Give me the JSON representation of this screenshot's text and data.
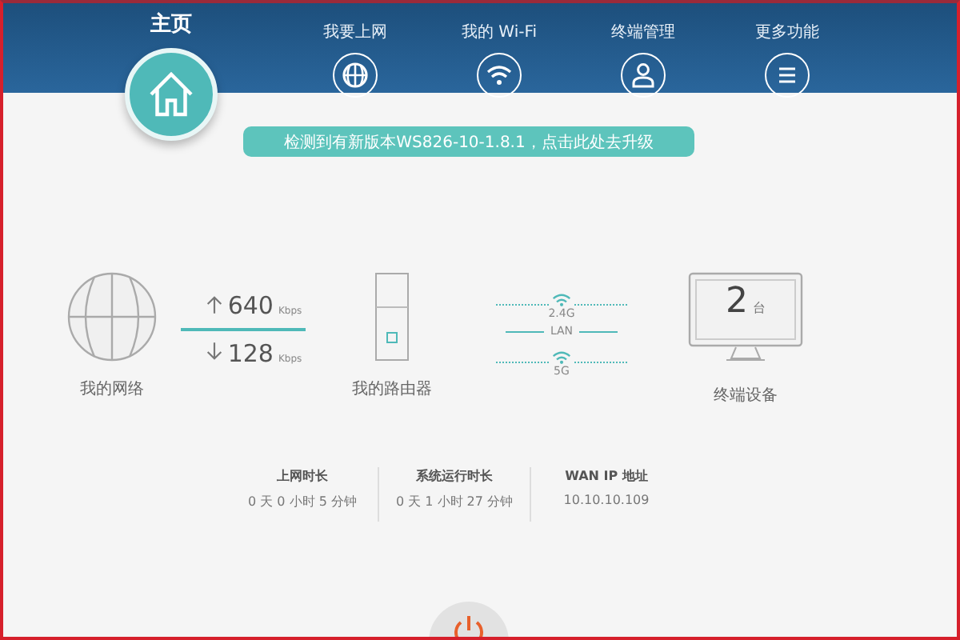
{
  "nav": [
    {
      "label": "主页",
      "selected": true,
      "kind": "home"
    },
    {
      "label": "我要上网",
      "selected": false,
      "kind": "internet"
    },
    {
      "label": "我的 Wi-Fi",
      "selected": false,
      "kind": "wifi"
    },
    {
      "label": "终端管理",
      "selected": false,
      "kind": "devices"
    },
    {
      "label": "更多功能",
      "selected": false,
      "kind": "more"
    }
  ],
  "update_banner": "检测到有新版本WS826-10-1.8.1，点击此处去升级",
  "network": {
    "label": "我的网络"
  },
  "speeds": {
    "up": "640",
    "up_unit": "Kbps",
    "down": "128",
    "down_unit": "Kbps"
  },
  "router": {
    "label": "我的路由器"
  },
  "bands": [
    {
      "label": "2.4G",
      "kind": "wifi"
    },
    {
      "label": "LAN",
      "kind": "wired"
    },
    {
      "label": "5G",
      "kind": "wifi"
    }
  ],
  "devices": {
    "count": "2",
    "unit": "台",
    "label": "终端设备"
  },
  "info": [
    {
      "title": "上网时长",
      "value": "0 天 0 小时 5 分钟"
    },
    {
      "title": "系统运行时长",
      "value": "0 天 1 小时 27 分钟"
    },
    {
      "title": "WAN IP 地址",
      "value": "10.10.10.109"
    }
  ]
}
